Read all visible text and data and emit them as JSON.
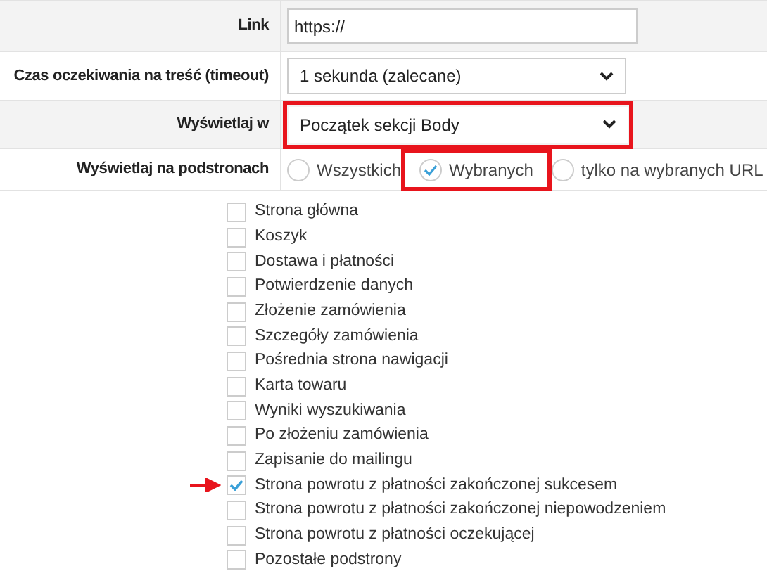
{
  "form": {
    "link": {
      "label": "Link",
      "value": "https://"
    },
    "timeout": {
      "label": "Czas oczekiwania na treść (timeout)",
      "value": "1 sekunda (zalecane)",
      "highlighted": false
    },
    "display_in": {
      "label": "Wyświetlaj w",
      "value": "Początek sekcji Body",
      "highlighted": true
    },
    "display_on": {
      "label": "Wyświetlaj na podstronach",
      "options": [
        {
          "label": "Wszystkich",
          "selected": false,
          "highlighted": false
        },
        {
          "label": "Wybranych",
          "selected": true,
          "highlighted": true
        },
        {
          "label": "tylko na wybranych URL",
          "selected": false,
          "highlighted": false
        }
      ]
    }
  },
  "pages": [
    {
      "label": "Strona główna",
      "checked": false,
      "pointed": false
    },
    {
      "label": "Koszyk",
      "checked": false,
      "pointed": false
    },
    {
      "label": "Dostawa i płatności",
      "checked": false,
      "pointed": false
    },
    {
      "label": "Potwierdzenie danych",
      "checked": false,
      "pointed": false
    },
    {
      "label": "Złożenie zamówienia",
      "checked": false,
      "pointed": false
    },
    {
      "label": "Szczegóły zamówienia",
      "checked": false,
      "pointed": false
    },
    {
      "label": "Pośrednia strona nawigacji",
      "checked": false,
      "pointed": false
    },
    {
      "label": "Karta towaru",
      "checked": false,
      "pointed": false
    },
    {
      "label": "Wyniki wyszukiwania",
      "checked": false,
      "pointed": false
    },
    {
      "label": "Po złożeniu zamówienia",
      "checked": false,
      "pointed": false
    },
    {
      "label": "Zapisanie do mailingu",
      "checked": false,
      "pointed": false
    },
    {
      "label": "Strona powrotu z płatności zakończonej sukcesem",
      "checked": true,
      "pointed": true
    },
    {
      "label": "Strona powrotu z płatności zakończonej niepowodzeniem",
      "checked": false,
      "pointed": false
    },
    {
      "label": "Strona powrotu z płatności oczekującej",
      "checked": false,
      "pointed": false
    },
    {
      "label": "Pozostałe podstrony",
      "checked": false,
      "pointed": false
    }
  ]
}
